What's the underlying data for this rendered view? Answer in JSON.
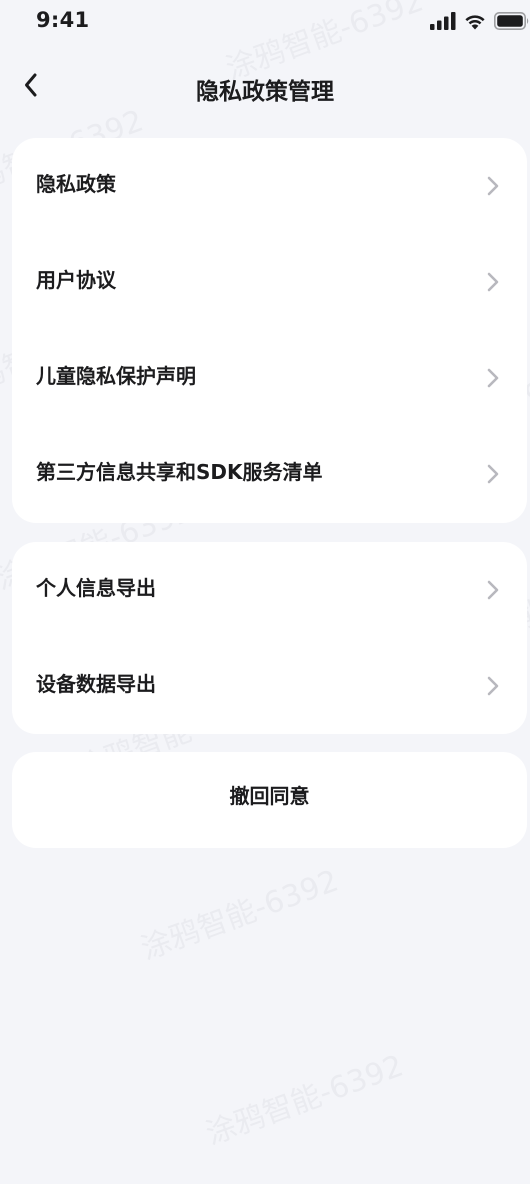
{
  "status_bar": {
    "time": "9:41",
    "icons": [
      "cellular-signal-icon",
      "wifi-icon",
      "battery-icon"
    ]
  },
  "header": {
    "title": "隐私政策管理",
    "back_icon": "chevron-left-icon"
  },
  "sections": [
    {
      "items": [
        {
          "label": "隐私政策"
        },
        {
          "label": "用户协议"
        },
        {
          "label": "儿童隐私保护声明"
        },
        {
          "label": "第三方信息共享和SDK服务清单"
        }
      ]
    },
    {
      "items": [
        {
          "label": "个人信息导出"
        },
        {
          "label": "设备数据导出"
        }
      ]
    }
  ],
  "revoke": {
    "label": "撤回同意"
  },
  "watermark": {
    "text": "涂鸦智能-6392"
  },
  "colors": {
    "background": "#f4f5f9",
    "card": "#ffffff",
    "text": "#1c1c1e",
    "chevron": "#b8b8be"
  }
}
